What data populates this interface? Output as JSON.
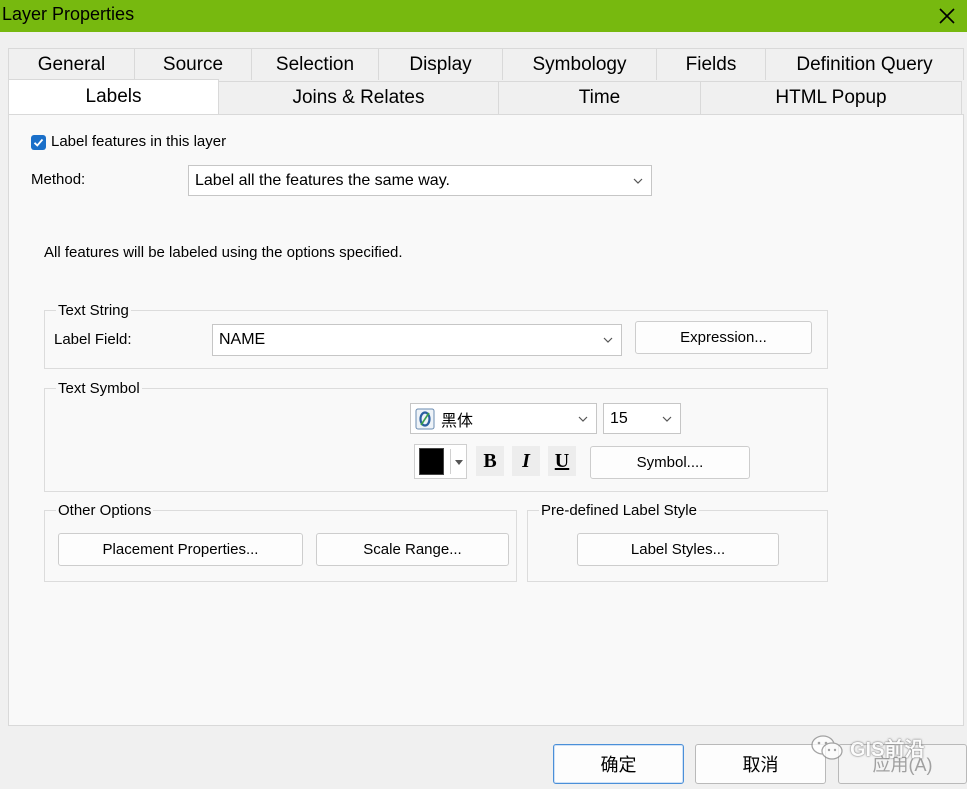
{
  "window": {
    "title": "Layer Properties",
    "accent_color": "#77b90f"
  },
  "tabs": {
    "row1": [
      "General",
      "Source",
      "Selection",
      "Display",
      "Symbology",
      "Fields",
      "Definition Query"
    ],
    "row2": [
      "Labels",
      "Joins & Relates",
      "Time",
      "HTML Popup"
    ],
    "active": "Labels"
  },
  "labels_page": {
    "enable_label": "Label features in this layer",
    "method_label": "Method:",
    "method_value": "Label all the features the same way.",
    "description": "All features will be labeled using the options specified.",
    "text_string": {
      "title": "Text String",
      "field_label": "Label Field:",
      "field_value": "NAME",
      "expression_button": "Expression..."
    },
    "text_symbol": {
      "title": "Text Symbol",
      "font": "黑体",
      "size": "15",
      "color": "#000000",
      "bold": "B",
      "italic": "I",
      "underline": "U",
      "symbol_button": "Symbol...."
    },
    "other_options": {
      "title": "Other Options",
      "placement_button": "Placement Properties...",
      "scale_button": "Scale Range..."
    },
    "predefined": {
      "title": "Pre-defined Label Style",
      "styles_button": "Label Styles..."
    }
  },
  "footer": {
    "ok": "确定",
    "cancel": "取消",
    "apply": "应用(A)",
    "watermark": "GIS前沿"
  }
}
